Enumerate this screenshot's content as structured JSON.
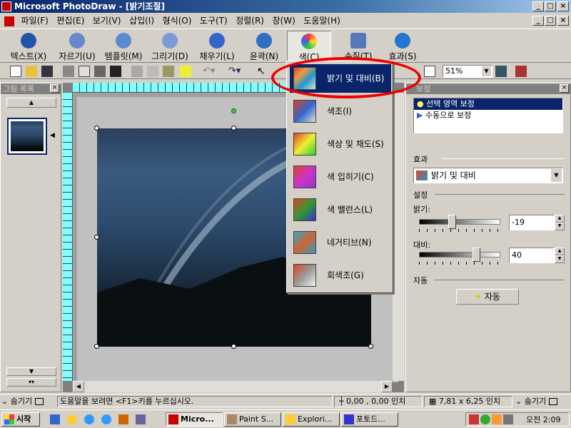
{
  "window": {
    "title": "Microsoft PhotoDraw - [밝기조절]"
  },
  "menu": [
    "파일(F)",
    "편집(E)",
    "보기(V)",
    "삽입(I)",
    "형식(O)",
    "도구(T)",
    "정렬(R)",
    "창(W)",
    "도움말(H)"
  ],
  "bigbar": [
    {
      "label": "텍스트(X)",
      "icon": "text-icon"
    },
    {
      "label": "자르기(U)",
      "icon": "scissors-icon"
    },
    {
      "label": "템플릿(M)",
      "icon": "template-icon"
    },
    {
      "label": "그리기(D)",
      "icon": "pencil-icon"
    },
    {
      "label": "채우기(L)",
      "icon": "fill-icon"
    },
    {
      "label": "윤곽(N)",
      "icon": "outline-icon"
    },
    {
      "label": "색(C)",
      "icon": "color-wheel-icon"
    },
    {
      "label": "손질(T)",
      "icon": "touchup-icon"
    },
    {
      "label": "효과(S)",
      "icon": "effects-icon"
    }
  ],
  "toolbar": {
    "zoom": "51%"
  },
  "gallery": {
    "title": "그림 목록"
  },
  "color_menu": {
    "items": [
      "밝기 및 대비(B)",
      "색조(I)",
      "색상 및 채도(S)",
      "색 입히기(C)",
      "색 밸런스(L)",
      "네거티브(N)",
      "회색조(G)"
    ],
    "selected": 0
  },
  "right_panel": {
    "title_fragment": "보정",
    "options": [
      "선택 영역 보정",
      "수동으로 보정"
    ],
    "effect_label": "효과",
    "effect_value": "밝기 및 대비",
    "settings_label": "설정",
    "brightness_label": "밝기:",
    "brightness_value": "-19",
    "brightness_level": -19,
    "contrast_label": "대비:",
    "contrast_value": "40",
    "contrast_level": 40,
    "auto_label": "자동",
    "auto_button": "자동"
  },
  "status": {
    "hide_left": "숨기기",
    "help": "도움말을 보려면 <F1>키를 누르십시오.",
    "position": "0,00 , 0,00 인치",
    "size": "7,81 x 6,25 인치",
    "hide_right": "숨기기"
  },
  "taskbar": {
    "start": "시작",
    "tasks": [
      "Micro...",
      "Paint S...",
      "Explori...",
      "포토드..."
    ],
    "clock": "오전 2:09"
  }
}
